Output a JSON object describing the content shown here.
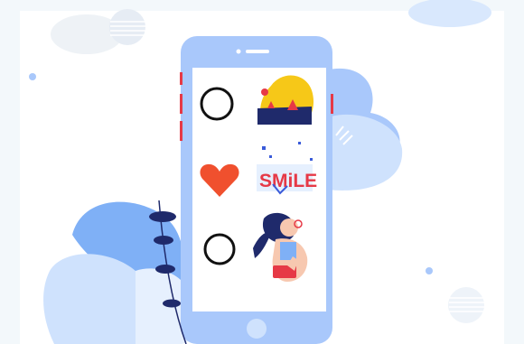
{
  "illustration": {
    "sticker_text": "SMiLE",
    "colors": {
      "page_bg": "#f3f8fb",
      "card_bg": "#ffffff",
      "phone_body": "#a9c8fb",
      "phone_screen": "#ffffff",
      "accent_blue": "#7fb0f6",
      "light_blue": "#cfe2fd",
      "pale_blue": "#e6f0fe",
      "heart_red": "#f0502e",
      "sticker_red": "#e63946",
      "sticker_blue": "#3a5bd9",
      "sun_yellow": "#f6c818",
      "leaf_navy": "#1f2a6b",
      "outline_black": "#111111"
    },
    "rows": [
      {
        "selector": "empty-circle",
        "sticker": "sunset-landscape-sticker"
      },
      {
        "selector": "heart",
        "sticker": "smile-text-sticker"
      },
      {
        "selector": "empty-circle",
        "sticker": "girl-thumbs-up-sticker"
      }
    ]
  }
}
